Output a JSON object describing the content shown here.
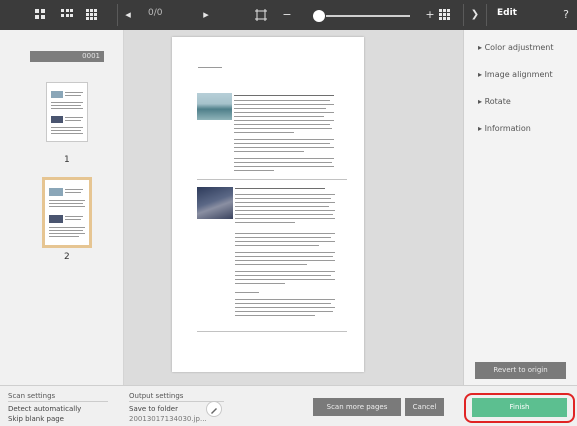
{
  "toolbar": {
    "page_counter": "0/0",
    "edit_label": "Edit",
    "help_icon": "?",
    "prev_glyph": "◂",
    "next_glyph": "▸",
    "minus_glyph": "−",
    "plus_glyph": "+",
    "collapse_glyph": "❯"
  },
  "thumbnails": {
    "tag_label": "0001",
    "items": [
      {
        "number": "1"
      },
      {
        "number": "2"
      }
    ]
  },
  "edit_panel": {
    "items": [
      {
        "label": "Color adjustment"
      },
      {
        "label": "Image alignment"
      },
      {
        "label": "Rotate"
      },
      {
        "label": "Information"
      }
    ],
    "revert_label": "Revert to origin"
  },
  "bottom": {
    "scan_settings_label": "Scan settings",
    "scan_settings_value_1": "Detect automatically",
    "scan_settings_value_2": "Skip blank page",
    "output_settings_label": "Output settings",
    "output_value_1": "Save to folder",
    "output_value_2": "20013017134030.jp...",
    "scan_more_label": "Scan more pages",
    "cancel_label": "Cancel",
    "finish_label": "Finish"
  },
  "colors": {
    "toolbar_bg": "#3b3b3b",
    "finish_green": "#5cbf90",
    "highlight_red": "#e02424",
    "selected_thumb": "#e6c592"
  }
}
